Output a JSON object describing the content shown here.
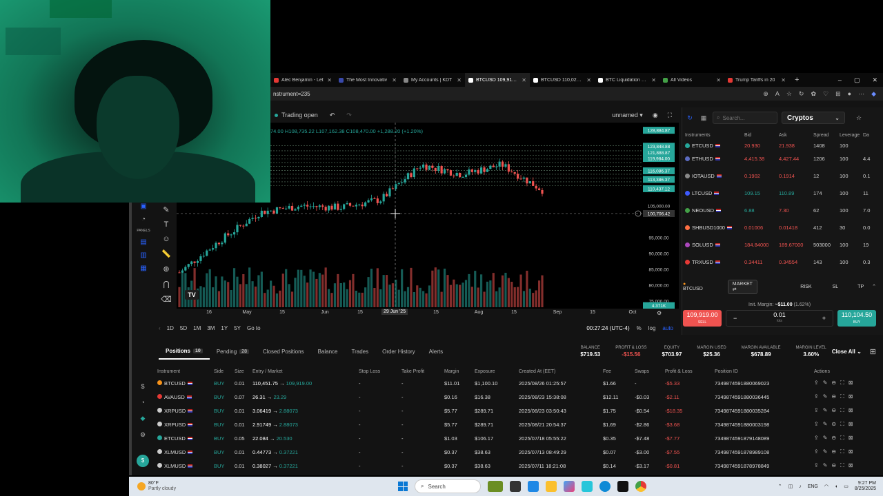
{
  "browser": {
    "tabs": [
      {
        "title": "Alec Benjamin - Let",
        "color": "#e53935",
        "active": false
      },
      {
        "title": "The Most Innovativ",
        "color": "#3949ab",
        "active": false
      },
      {
        "title": "My Accounts | KDT",
        "color": "#888888",
        "active": false
      },
      {
        "title": "BTCUSD 109,919.00",
        "color": "#ffffff",
        "active": true
      },
      {
        "title": "BTCUSD 110,023 ▼",
        "color": "#ffffff",
        "active": false
      },
      {
        "title": "BTC Liquidation Lev",
        "color": "#ffffff",
        "active": false
      },
      {
        "title": "All Videos",
        "color": "#43a047",
        "active": false
      },
      {
        "title": "Trump Tariffs in 20",
        "color": "#e53935",
        "active": false
      }
    ],
    "new_tab": "+",
    "window_controls": [
      "–",
      "▢",
      "✕"
    ],
    "url": "nstrument=235"
  },
  "chart": {
    "status": "Trading open",
    "layout_name": "unnamed",
    "ohlc": "74.00 H108,735.22 L107,162.38 C108,470.00 +1,288.20 (+1.20%)",
    "crosshair_price": "100,706.42",
    "crosshair_date": "29 Jun '25",
    "timer": "00:27:24 (UTC-4)",
    "price_labels": [
      "128,884.87",
      "123,848.88",
      "121,888.87",
      "119,984.00",
      "116,086.37",
      "113,386.37",
      "110,437.12",
      "105,000.00",
      "95,000.00",
      "90,000.00",
      "85,000.00",
      "80,000.00",
      "75,000.00",
      "4.371K"
    ],
    "x_labels": [
      "16",
      "May",
      "15",
      "Jun",
      "15",
      "Jul",
      "15",
      "Aug",
      "15",
      "Sep",
      "15",
      "Oct"
    ],
    "timeframes": [
      "1D",
      "5D",
      "1M",
      "3M",
      "1Y",
      "5Y",
      "Go to"
    ],
    "scale_opts": [
      "%",
      "log",
      "auto"
    ]
  },
  "chart_data": {
    "type": "candlestick",
    "x": [
      "Apr 14",
      "May 1",
      "May 15",
      "Jun 1",
      "Jun 15",
      "Jul 1",
      "Jul 15",
      "Aug 1",
      "Aug 15",
      "Aug 25"
    ],
    "y_trend": [
      84000,
      94000,
      103000,
      105000,
      104500,
      107000,
      118000,
      115000,
      118000,
      110000
    ],
    "ylim": [
      73000,
      130000
    ],
    "grid": true
  },
  "tools": {
    "panels_label": "PANELS"
  },
  "right_panel": {
    "search_placeholder": "Search...",
    "category": "Cryptos",
    "columns": [
      "Instruments",
      "Bid",
      "Ask",
      "Spread",
      "Leverage",
      "Da"
    ],
    "instruments": [
      {
        "name": "ETCUSD",
        "bid": "20.930",
        "ask": "21.938",
        "spread": "1408",
        "lev": "100",
        "day": "",
        "color": "#26a69a"
      },
      {
        "name": "ETHUSD",
        "bid": "4,415.38",
        "ask": "4,427.44",
        "spread": "1206",
        "lev": "100",
        "day": "4.4",
        "color": "#5c6bc0"
      },
      {
        "name": "IOTAUSD",
        "bid": "0.1902",
        "ask": "0.1914",
        "spread": "12",
        "lev": "100",
        "day": "0.1",
        "color": "#888888"
      },
      {
        "name": "LTCUSD",
        "bid": "109.15",
        "ask": "110.89",
        "spread": "174",
        "lev": "100",
        "day": "11",
        "color": "#3d5afe"
      },
      {
        "name": "NEOUSD",
        "bid": "6.88",
        "ask": "7.30",
        "spread": "62",
        "lev": "100",
        "day": "7.0",
        "color": "#43a047"
      },
      {
        "name": "SHBUSD1000",
        "bid": "0.01006",
        "ask": "0.01418",
        "spread": "412",
        "lev": "30",
        "day": "0.0",
        "color": "#ff7043"
      },
      {
        "name": "SOLUSD",
        "bid": "184.84000",
        "ask": "189.67000",
        "spread": "503000",
        "lev": "100",
        "day": "19",
        "color": "#ab47bc"
      },
      {
        "name": "TRXUSD",
        "bid": "0.34411",
        "ask": "0.34554",
        "spread": "143",
        "lev": "100",
        "day": "0.3",
        "color": "#e53935"
      }
    ]
  },
  "ticket": {
    "symbol": "BTCUSD",
    "order_type": "MARKET",
    "risk": "RISK",
    "sl": "SL",
    "tp": "TP",
    "margin_label": "Init. Margin:",
    "margin_value": "~$11.00",
    "margin_pct": "(1.62%)",
    "sell_price": "109,919.00",
    "sell_label": "SELL",
    "qty": "0.01",
    "qty_unit": "lots",
    "buy_price": "110,104.50",
    "buy_label": "BUY"
  },
  "account": {
    "tabs": [
      {
        "label": "Positions",
        "count": "10",
        "active": true
      },
      {
        "label": "Pending",
        "count": "28",
        "active": false
      },
      {
        "label": "Closed Positions",
        "count": "",
        "active": false
      },
      {
        "label": "Balance",
        "count": "",
        "active": false
      },
      {
        "label": "Trades",
        "count": "",
        "active": false
      },
      {
        "label": "Order History",
        "count": "",
        "active": false
      },
      {
        "label": "Alerts",
        "count": "",
        "active": false
      }
    ],
    "metrics": [
      {
        "label": "BALANCE",
        "value": "$719.53",
        "neg": false
      },
      {
        "label": "PROFIT & LOSS",
        "value": "-$15.56",
        "neg": true
      },
      {
        "label": "EQUITY",
        "value": "$703.97",
        "neg": false
      },
      {
        "label": "MARGIN USED",
        "value": "$25.36",
        "neg": false
      },
      {
        "label": "MARGIN AVAILABLE",
        "value": "$678.89",
        "neg": false
      },
      {
        "label": "MARGIN LEVEL",
        "value": "3.60%",
        "neg": false
      }
    ],
    "close_all": "Close All"
  },
  "positions": {
    "columns": [
      "Instrument",
      "Side",
      "Size",
      "Entry / Market",
      "Stop Loss",
      "Take Profit",
      "Margin",
      "Exposure",
      "Created At (EET)",
      "Fee",
      "Swaps",
      "Profit & Loss",
      "Position ID",
      "Actions"
    ],
    "rows": [
      {
        "instrument": "BTCUSD",
        "side": "BUY",
        "size": "0.01",
        "entry": "110,451.75",
        "market": "109,919.00",
        "sl": "-",
        "tp": "-",
        "margin": "$11.01",
        "exposure": "$1,100.10",
        "created": "2025/08/26 01:25:57",
        "fee": "$1.66",
        "swaps": "-",
        "pnl": "-$5.33",
        "id": "7349874591880069023",
        "color": "#f7931a"
      },
      {
        "instrument": "AVAUSD",
        "side": "BUY",
        "size": "0.07",
        "entry": "26.31",
        "market": "23.29",
        "sl": "-",
        "tp": "-",
        "margin": "$0.16",
        "exposure": "$16.38",
        "created": "2025/08/23 15:38:08",
        "fee": "$12.11",
        "swaps": "-$0.03",
        "pnl": "-$2.11",
        "id": "7349874591880036445",
        "color": "#e53935"
      },
      {
        "instrument": "XRPUSD",
        "side": "BUY",
        "size": "0.01",
        "entry": "3.06419",
        "market": "2.88073",
        "sl": "-",
        "tp": "-",
        "margin": "$5.77",
        "exposure": "$289.71",
        "created": "2025/08/23 03:50:43",
        "fee": "$1.75",
        "swaps": "-$0.54",
        "pnl": "-$18.35",
        "id": "7349874591880035284",
        "color": "#cccccc"
      },
      {
        "instrument": "XRPUSD",
        "side": "BUY",
        "size": "0.01",
        "entry": "2.91749",
        "market": "2.88073",
        "sl": "-",
        "tp": "-",
        "margin": "$5.77",
        "exposure": "$289.71",
        "created": "2025/08/21 20:54:37",
        "fee": "$1.69",
        "swaps": "-$2.86",
        "pnl": "-$3.68",
        "id": "7349874591880003198",
        "color": "#cccccc"
      },
      {
        "instrument": "ETCUSD",
        "side": "BUY",
        "size": "0.05",
        "entry": "22.084",
        "market": "20.530",
        "sl": "-",
        "tp": "-",
        "margin": "$1.03",
        "exposure": "$106.17",
        "created": "2025/07/18 05:55:22",
        "fee": "$0.35",
        "swaps": "-$7.48",
        "pnl": "-$7.77",
        "id": "7349874591879148089",
        "color": "#26a69a"
      },
      {
        "instrument": "XLMUSD",
        "side": "BUY",
        "size": "0.01",
        "entry": "0.44773",
        "market": "0.37221",
        "sl": "-",
        "tp": "-",
        "margin": "$0.37",
        "exposure": "$38.63",
        "created": "2025/07/13 08:49:29",
        "fee": "$0.07",
        "swaps": "-$3.00",
        "pnl": "-$7.55",
        "id": "7349874591878989108",
        "color": "#cccccc"
      },
      {
        "instrument": "XLMUSD",
        "side": "BUY",
        "size": "0.01",
        "entry": "0.38027",
        "market": "0.37221",
        "sl": "-",
        "tp": "-",
        "margin": "$0.37",
        "exposure": "$38.63",
        "created": "2025/07/11 18:21:08",
        "fee": "$0.14",
        "swaps": "-$3.17",
        "pnl": "-$0.81",
        "id": "7349874591878978849",
        "color": "#cccccc"
      }
    ]
  },
  "taskbar": {
    "temp": "80°F",
    "weather": "Partly cloudy",
    "search": "Search",
    "lang": "ENG",
    "time": "9:27 PM",
    "date": "8/25/2025"
  }
}
